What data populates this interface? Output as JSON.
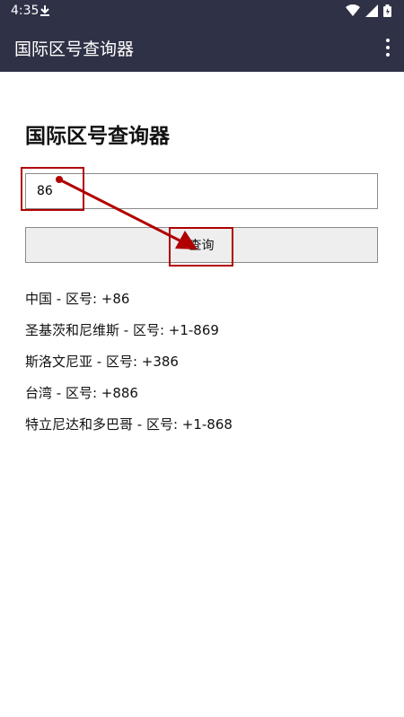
{
  "status_bar": {
    "time": "4:35",
    "download_icon": "download-icon",
    "icons": [
      "wifi-icon",
      "signal-icon",
      "battery-icon"
    ]
  },
  "app_bar": {
    "title": "国际区号查询器",
    "menu_icon": "overflow-menu-icon"
  },
  "main": {
    "heading": "国际区号查询器",
    "input": {
      "value": "86",
      "placeholder": ""
    },
    "button_label": "查询",
    "results": [
      "中国 - 区号: +86",
      "圣基茨和尼维斯 - 区号: +1-869",
      "斯洛文尼亚 - 区号: +386",
      "台湾 - 区号: +886",
      "特立尼达和多巴哥 - 区号: +1-868"
    ]
  },
  "annotation": {
    "color": "#b00000"
  },
  "colors": {
    "app_bar": "#2f3146",
    "button_bg": "#eeeeee",
    "annotation": "#b00000"
  }
}
